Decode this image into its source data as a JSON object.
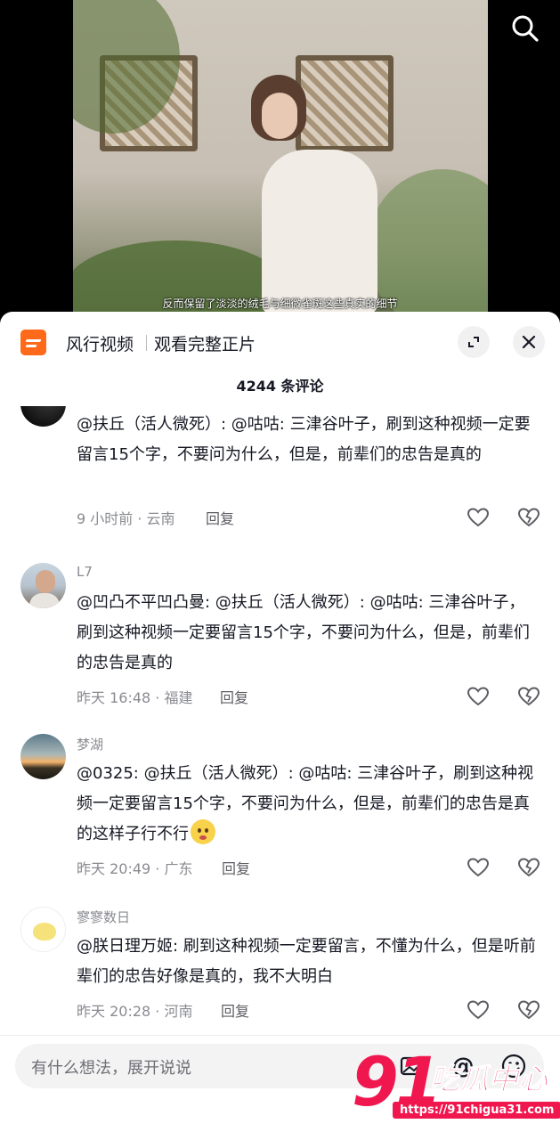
{
  "video": {
    "subtitle": "反而保留了淡淡的绒毛与细微雀斑这些真实的细节"
  },
  "promo": {
    "app_name": "风行视频",
    "cta": "观看完整正片"
  },
  "comment_count_label": "4244 条评论",
  "comments": [
    {
      "author": "",
      "text": "@扶丘（活人微死）: @咕咕: 三津谷叶子，刷到这种视频一定要留言15个字，不要问为什么，但是，前辈们的忠告是真的",
      "time": "9 小时前 · 云南",
      "reply": "回复"
    },
    {
      "author": "L7",
      "text": "@凹凸不平凹凸曼: @扶丘（活人微死）: @咕咕: 三津谷叶子，刷到这种视频一定要留言15个字，不要问为什么，但是，前辈们的忠告是真的",
      "time": "昨天 16:48 · 福建",
      "reply": "回复"
    },
    {
      "author": "梦湖",
      "text": "@0325: @扶丘（活人微死）: @咕咕: 三津谷叶子，刷到这种视频一定要留言15个字，不要问为什么，但是，前辈们的忠告是真的这样子行不行",
      "time": "昨天 20:49 · 广东",
      "reply": "回复"
    },
    {
      "author": "寥寥数日",
      "text": "@朕日理万姬: 刷到这种视频一定要留言，不懂为什么，但是听前辈们的忠告好像是真的，我不大明白",
      "time": "昨天 20:28 · 河南",
      "reply": "回复"
    }
  ],
  "input": {
    "placeholder": "有什么想法，展开说说",
    "at_symbol": "@"
  },
  "watermark": {
    "number": "91",
    "name": "吃瓜中心",
    "url": "https://91chigua31.com"
  },
  "colors": {
    "brand_orange": "#ff6a1a",
    "watermark_pink": "#f0174f",
    "meta_gray": "#8a8b91"
  },
  "icons": [
    "search-icon",
    "expand-icon",
    "close-icon",
    "like-icon",
    "dislike-icon",
    "image-icon",
    "emoji-icon"
  ]
}
